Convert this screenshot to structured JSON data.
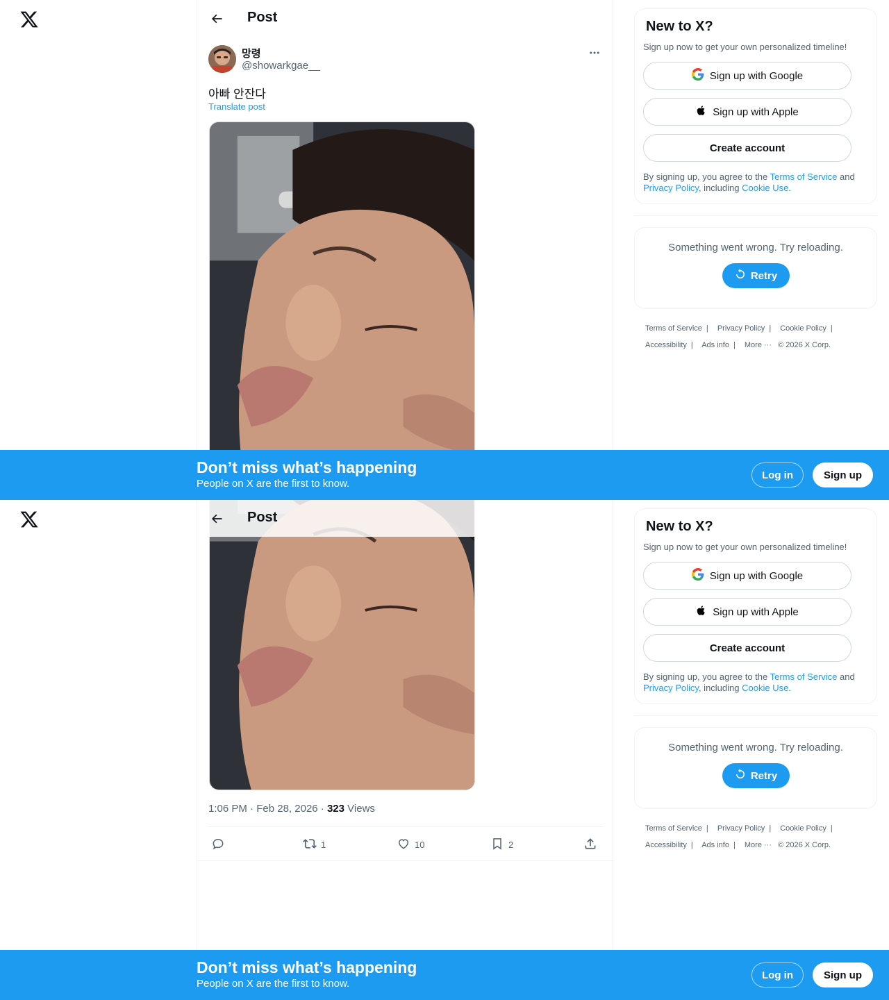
{
  "header": {
    "title": "Post"
  },
  "post": {
    "author_name": "망령",
    "author_handle": "@showarkgae__",
    "text": "아빠 안잔다",
    "translate_label": "Translate post",
    "time": "1:06 PM",
    "date": "Feb 28, 2026",
    "views_count": "323",
    "views_label": "Views",
    "dot": "·",
    "stats": {
      "replies": "",
      "reposts": "1",
      "likes": "10",
      "bookmarks": "2"
    }
  },
  "sidebar": {
    "new_title": "New to X?",
    "new_sub": "Sign up now to get your own personalized timeline!",
    "google_label": "Sign up with Google",
    "apple_label": "Sign up with Apple",
    "create_label": "Create account",
    "legal_prefix": "By signing up, you agree to the ",
    "legal_tos": "Terms of Service",
    "legal_and": " and ",
    "legal_privacy": "Privacy Policy",
    "legal_including": ", including ",
    "legal_cookie": "Cookie Use.",
    "error_text": "Something went wrong. Try reloading.",
    "retry_label": "Retry",
    "footer": {
      "terms": "Terms of Service",
      "privacy": "Privacy Policy",
      "cookie": "Cookie Policy",
      "accessibility": "Accessibility",
      "ads": "Ads info",
      "more": "More ···",
      "copyright": "© 2026 X Corp."
    }
  },
  "banner": {
    "title": "Don’t miss what’s happening",
    "subtitle": "People on X are the first to know.",
    "login": "Log in",
    "signup": "Sign up"
  },
  "colors": {
    "accent": "#1d9bf0",
    "text": "#0f1419",
    "muted": "#536471",
    "border": "#eff3f4"
  }
}
